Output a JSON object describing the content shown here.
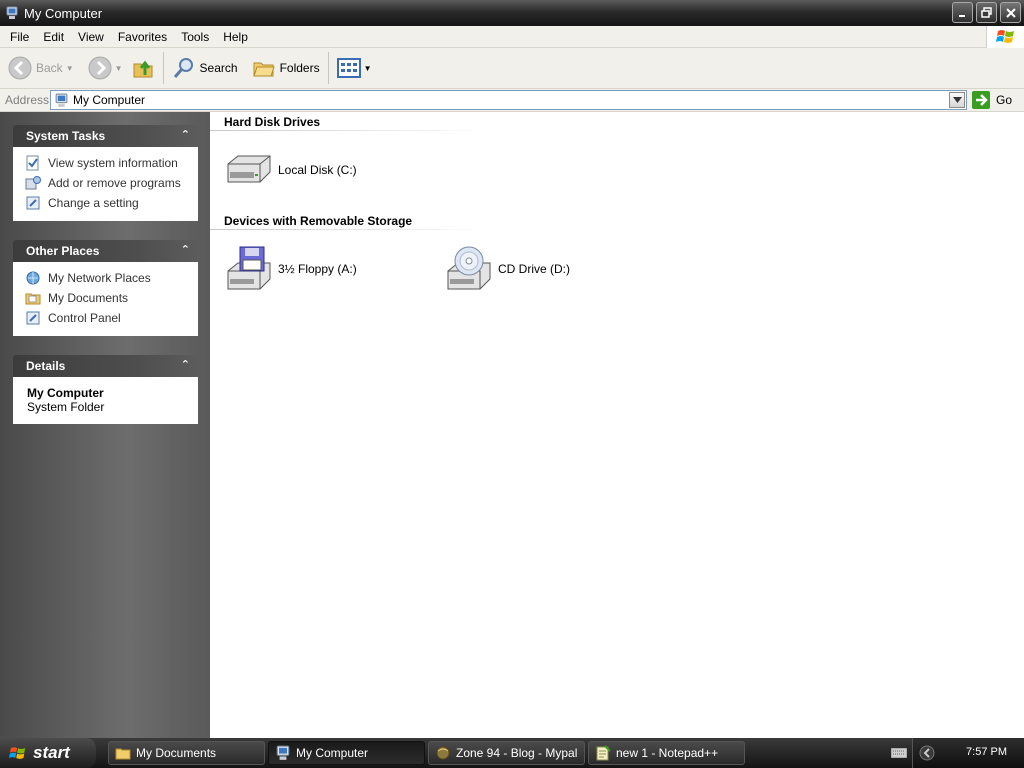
{
  "window": {
    "title": "My Computer"
  },
  "menu": [
    "File",
    "Edit",
    "View",
    "Favorites",
    "Tools",
    "Help"
  ],
  "toolbar": {
    "back_label": "Back",
    "search_label": "Search",
    "folders_label": "Folders"
  },
  "address": {
    "label": "Address",
    "value": "My Computer",
    "go_label": "Go"
  },
  "task_pane": {
    "system_tasks": {
      "title": "System Tasks",
      "items": [
        "View system information",
        "Add or remove programs",
        "Change a setting"
      ]
    },
    "other_places": {
      "title": "Other Places",
      "items": [
        "My Network Places",
        "My Documents",
        "Control Panel"
      ]
    },
    "details": {
      "title": "Details",
      "name": "My Computer",
      "type": "System Folder"
    }
  },
  "content": {
    "hard_disk_drives": {
      "title": "Hard Disk Drives",
      "items": [
        "Local Disk (C:)"
      ]
    },
    "removable_storage": {
      "title": "Devices with Removable Storage",
      "items": [
        "3½ Floppy (A:)",
        "CD Drive (D:)"
      ]
    }
  },
  "taskbar": {
    "start_label": "start",
    "tasks": [
      "My Documents",
      "My Computer",
      "Zone 94 - Blog - Mypal",
      "new 1 - Notepad++"
    ],
    "clock": "7:57 PM"
  }
}
